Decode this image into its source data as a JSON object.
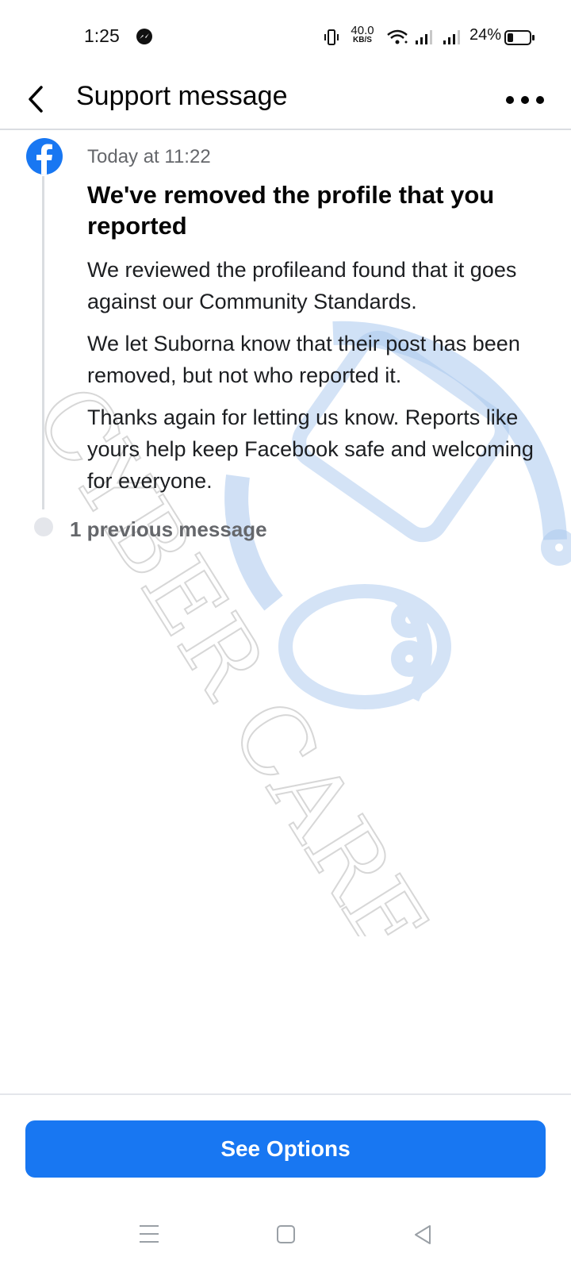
{
  "status_bar": {
    "time": "1:25",
    "net_speed_value": "40.0",
    "net_speed_unit": "KB/S",
    "battery_percent": "24%",
    "battery_level": 0.24,
    "icons": [
      "messenger-icon",
      "vibrate-icon",
      "wifi-icon",
      "signal-icon",
      "signal-icon",
      "battery-icon"
    ]
  },
  "header": {
    "title": "Support message",
    "back_icon": "chevron-left-icon",
    "more_icon": "more-horizontal-icon"
  },
  "message": {
    "sender_icon": "facebook-icon",
    "timestamp": "Today at 11:22",
    "title": "We've removed the profile that you reported",
    "paragraphs": [
      "We reviewed the profileand found that it goes against our Community Standards.",
      "We let Suborna know that their post has been removed, but not who reported it.",
      "Thanks again for letting us know. Reports like yours help keep Facebook safe and welcoming for everyone."
    ],
    "previous_messages": "1 previous message"
  },
  "watermark": {
    "text": "CYBER CARE"
  },
  "footer": {
    "options_label": "See Options"
  },
  "nav_bar": {
    "icons": [
      "menu-icon",
      "home-icon",
      "back-triangle-icon"
    ]
  },
  "colors": {
    "accent": "#1877f2",
    "secondary_text": "#65676b",
    "divider": "#dadde1"
  }
}
